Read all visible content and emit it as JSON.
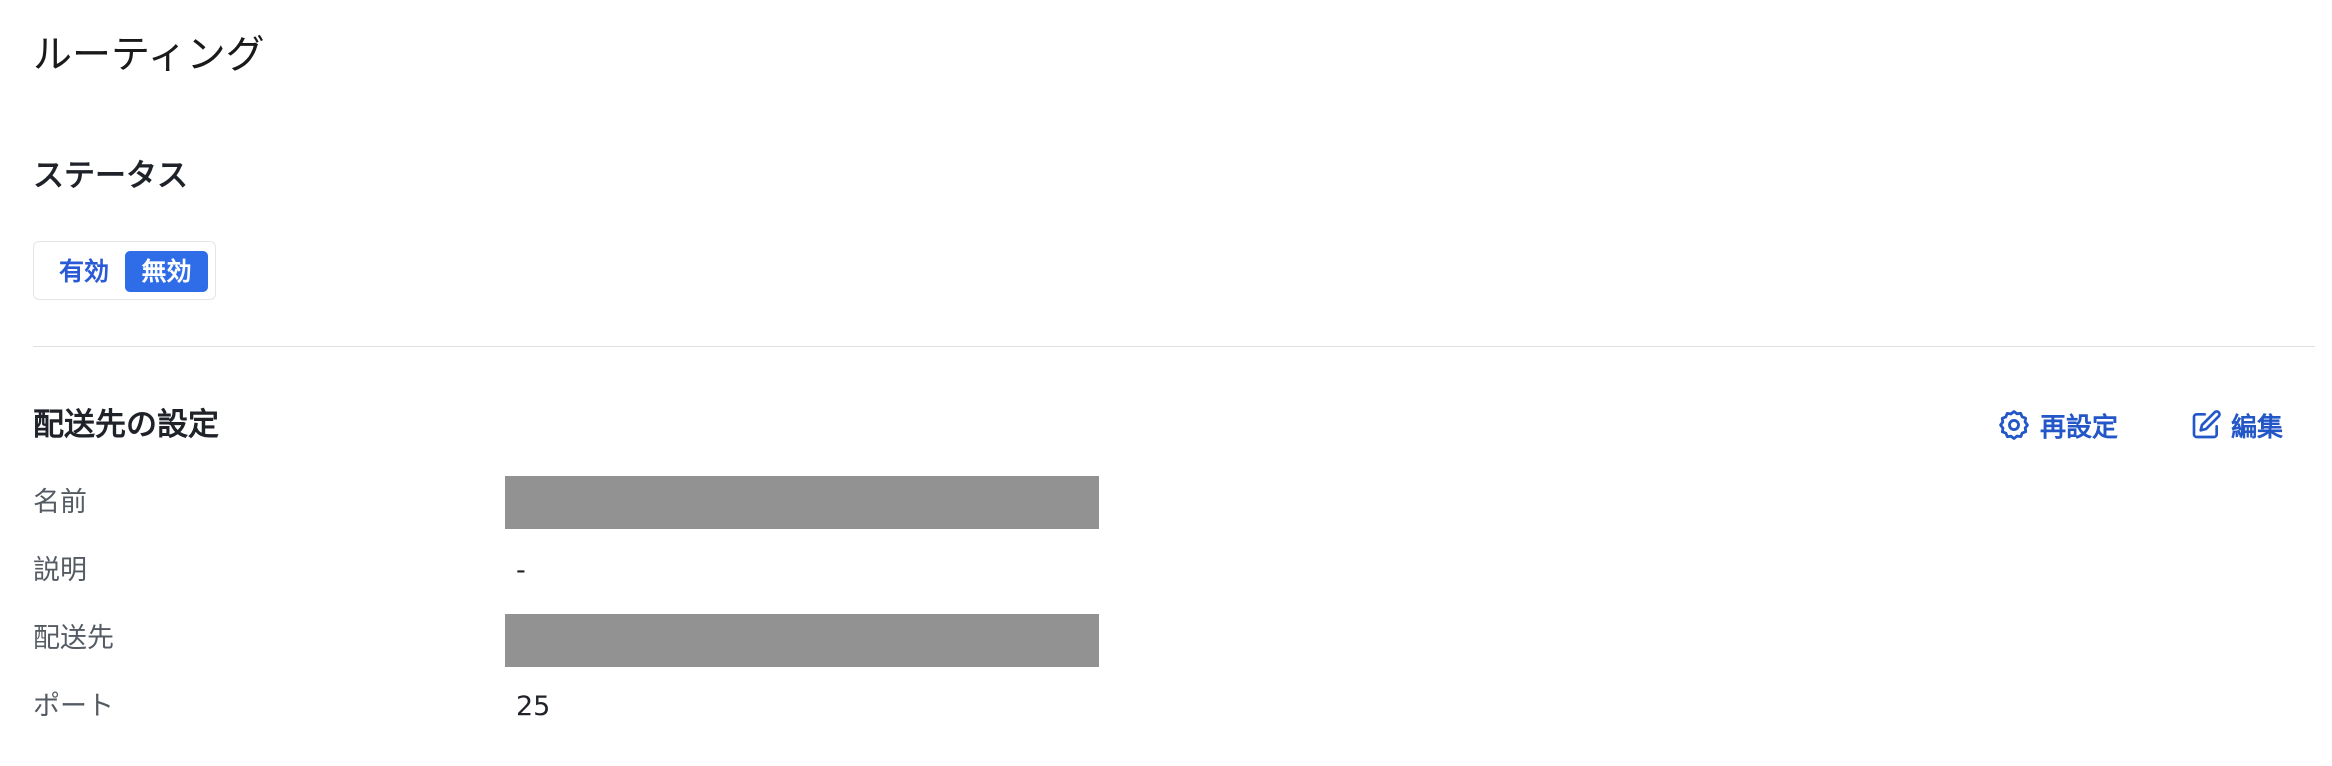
{
  "page": {
    "title": "ルーティング"
  },
  "status_section": {
    "title": "ステータス",
    "toggle": {
      "options": [
        "有効",
        "無効"
      ],
      "selected": "無効"
    }
  },
  "destination_section": {
    "title": "配送先の設定",
    "actions": {
      "reset_label": "再設定",
      "reset_icon": "gear-icon",
      "edit_label": "編集",
      "edit_icon": "edit-icon"
    },
    "fields": {
      "name_label": "名前",
      "description_label": "説明",
      "description_value": "-",
      "destination_label": "配送先",
      "port_label": "ポート",
      "port_value": "25"
    }
  },
  "colors": {
    "accent": "#2f6de8",
    "link": "#2356c7",
    "redacted": "#929292",
    "divider": "#dcdfe3"
  }
}
